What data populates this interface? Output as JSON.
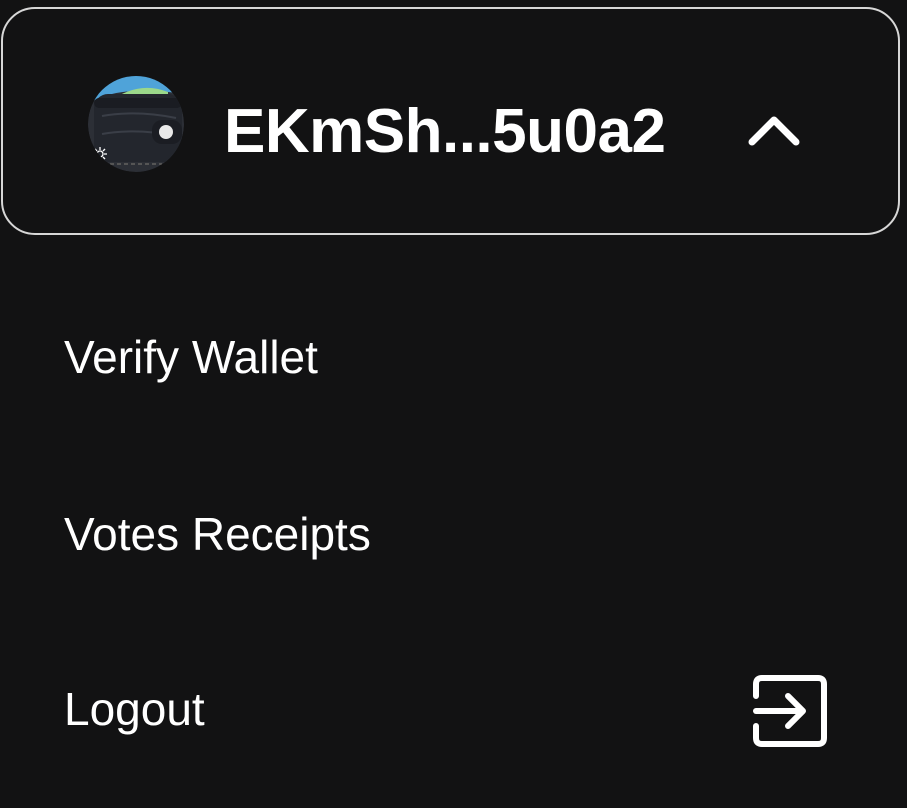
{
  "wallet": {
    "address_short": "EKmSh...5u0a2",
    "avatar_icon": "wallet-avatar-icon",
    "toggle_icon": "chevron-up-icon",
    "expanded": true
  },
  "menu": {
    "items": [
      {
        "label": "Verify Wallet"
      },
      {
        "label": "Votes Receipts"
      },
      {
        "label": "Logout",
        "icon": "logout-icon"
      }
    ]
  },
  "colors": {
    "background": "#121213",
    "border": "#d7d7d7",
    "text": "#ffffff"
  }
}
